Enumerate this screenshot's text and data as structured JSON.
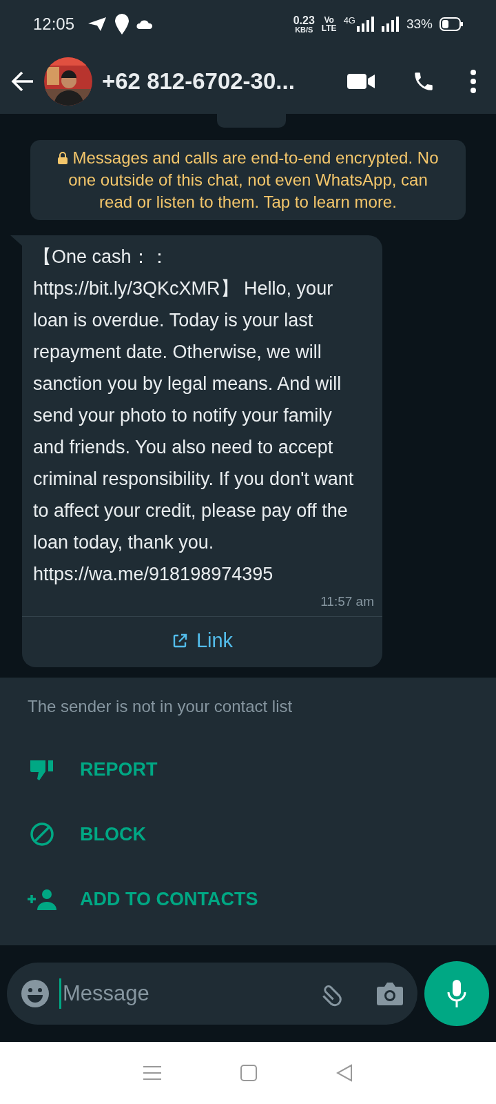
{
  "status_bar": {
    "time": "12:05",
    "speed": "0.23",
    "speed_unit": "KB/S",
    "volte_top": "Vo",
    "volte_bottom": "LTE",
    "network": "4G",
    "battery": "33%"
  },
  "header": {
    "title": "+62 812-6702-30..."
  },
  "encryption_notice": "Messages and calls are end-to-end encrypted. No one outside of this chat, not even WhatsApp, can read or listen to them. Tap to learn more.",
  "message": {
    "text": "【One cash：：https://bit.ly/3QKcXMR】 Hello, your loan is overdue. Today is your last repayment date. Otherwise, we will sanction you by legal means. And will send your photo to notify your family and friends. You also need to accept criminal responsibility. If you don't want to affect your credit, please pay off the loan today, thank you. https://wa.me/918198974395",
    "time": "11:57 am",
    "link_label": "Link"
  },
  "unknown_sender": {
    "notice": "The sender is not in your contact list",
    "actions": [
      {
        "kind": "report",
        "label": "REPORT"
      },
      {
        "kind": "block",
        "label": "BLOCK"
      },
      {
        "kind": "add",
        "label": "ADD TO CONTACTS"
      }
    ]
  },
  "composer": {
    "placeholder": "Message"
  }
}
